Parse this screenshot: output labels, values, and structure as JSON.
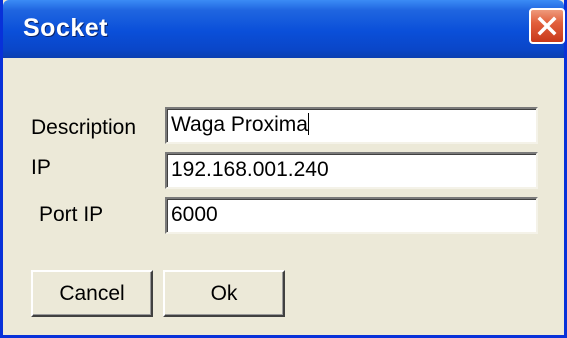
{
  "window": {
    "title": "Socket"
  },
  "form": {
    "description": {
      "label": "Description",
      "value": "Waga Proxima"
    },
    "ip": {
      "label": "IP",
      "value": "192.168.001.240"
    },
    "port": {
      "label": "Port IP",
      "value": "6000"
    }
  },
  "buttons": {
    "cancel": "Cancel",
    "ok": "Ok"
  },
  "icons": {
    "close": "close-icon"
  }
}
